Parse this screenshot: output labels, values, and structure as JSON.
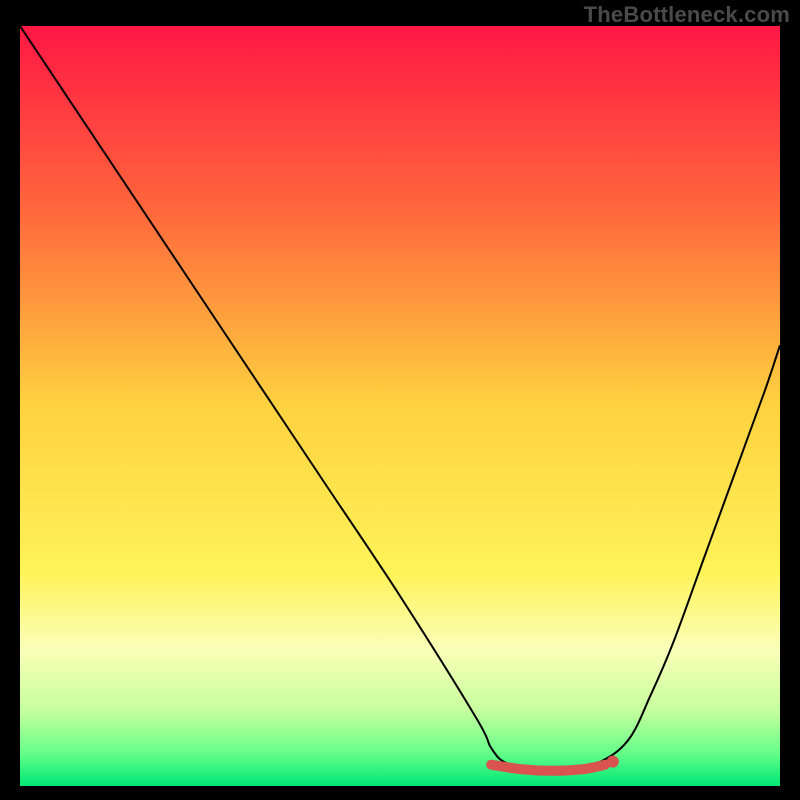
{
  "watermark": "TheBottleneck.com",
  "chart_data": {
    "type": "line",
    "title": "",
    "xlabel": "",
    "ylabel": "",
    "xlim": [
      0,
      100
    ],
    "ylim": [
      0,
      100
    ],
    "grid": false,
    "legend": false,
    "background_gradient": {
      "stops": [
        {
          "offset": 0.0,
          "color": "#ff1744"
        },
        {
          "offset": 0.25,
          "color": "#ff6a3c"
        },
        {
          "offset": 0.5,
          "color": "#ffd23f"
        },
        {
          "offset": 0.72,
          "color": "#fff35a"
        },
        {
          "offset": 0.82,
          "color": "#faffb8"
        },
        {
          "offset": 0.9,
          "color": "#c7ff9e"
        },
        {
          "offset": 0.955,
          "color": "#68ff8a"
        },
        {
          "offset": 1.0,
          "color": "#00e676"
        }
      ]
    },
    "series": [
      {
        "name": "bottleneck-curve",
        "type": "line",
        "color": "#000000",
        "x": [
          0,
          10,
          20,
          30,
          40,
          50,
          60,
          62,
          64,
          68,
          72,
          76,
          80,
          83,
          86,
          90,
          94,
          98,
          100
        ],
        "values": [
          100,
          85,
          70,
          55,
          40,
          25,
          9,
          5,
          3,
          2,
          2,
          3,
          6,
          12,
          19,
          30,
          41,
          52,
          58
        ]
      },
      {
        "name": "optimal-range-marker",
        "type": "line",
        "color": "#d9534f",
        "stroke_width": 10,
        "x": [
          62,
          66,
          70,
          74,
          77
        ],
        "values": [
          2.8,
          2.2,
          2.0,
          2.2,
          2.8
        ]
      },
      {
        "name": "optimal-range-marker-dot",
        "type": "scatter",
        "color": "#d9534f",
        "x": [
          78
        ],
        "values": [
          3.2
        ]
      }
    ],
    "annotations": [],
    "optimal_range": {
      "x_start": 62,
      "x_end": 78,
      "y": 2.0
    }
  }
}
